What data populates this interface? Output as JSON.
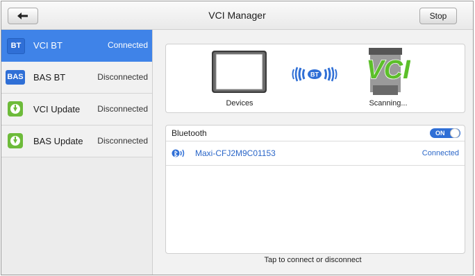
{
  "header": {
    "title": "VCI Manager",
    "stop_label": "Stop",
    "back_icon": "back-arrow-icon"
  },
  "sidebar": {
    "items": [
      {
        "badge": "BT",
        "label": "VCI BT",
        "status": "Connected",
        "active": true
      },
      {
        "badge": "BAS",
        "label": "BAS BT",
        "status": "Disconnected",
        "active": false
      },
      {
        "badge": "download-icon",
        "label": "VCI Update",
        "status": "Disconnected",
        "active": false
      },
      {
        "badge": "download-icon",
        "label": "BAS Update",
        "status": "Disconnected",
        "active": false
      }
    ]
  },
  "device_panel": {
    "devices_label": "Devices",
    "signal_badge": "BT",
    "vci_logo": "VCI",
    "scanning_label": "Scanning..."
  },
  "bluetooth": {
    "title": "Bluetooth",
    "toggle_label": "ON",
    "devices": [
      {
        "name": "Maxi-CFJ2M9C01153",
        "status": "Connected"
      }
    ]
  },
  "footer": {
    "hint": "Tap to connect or disconnect"
  },
  "colors": {
    "accent": "#3f83e8",
    "link": "#2a66c8",
    "update_green": "#6dbb3a",
    "vci_green": "#5cbf2a"
  }
}
